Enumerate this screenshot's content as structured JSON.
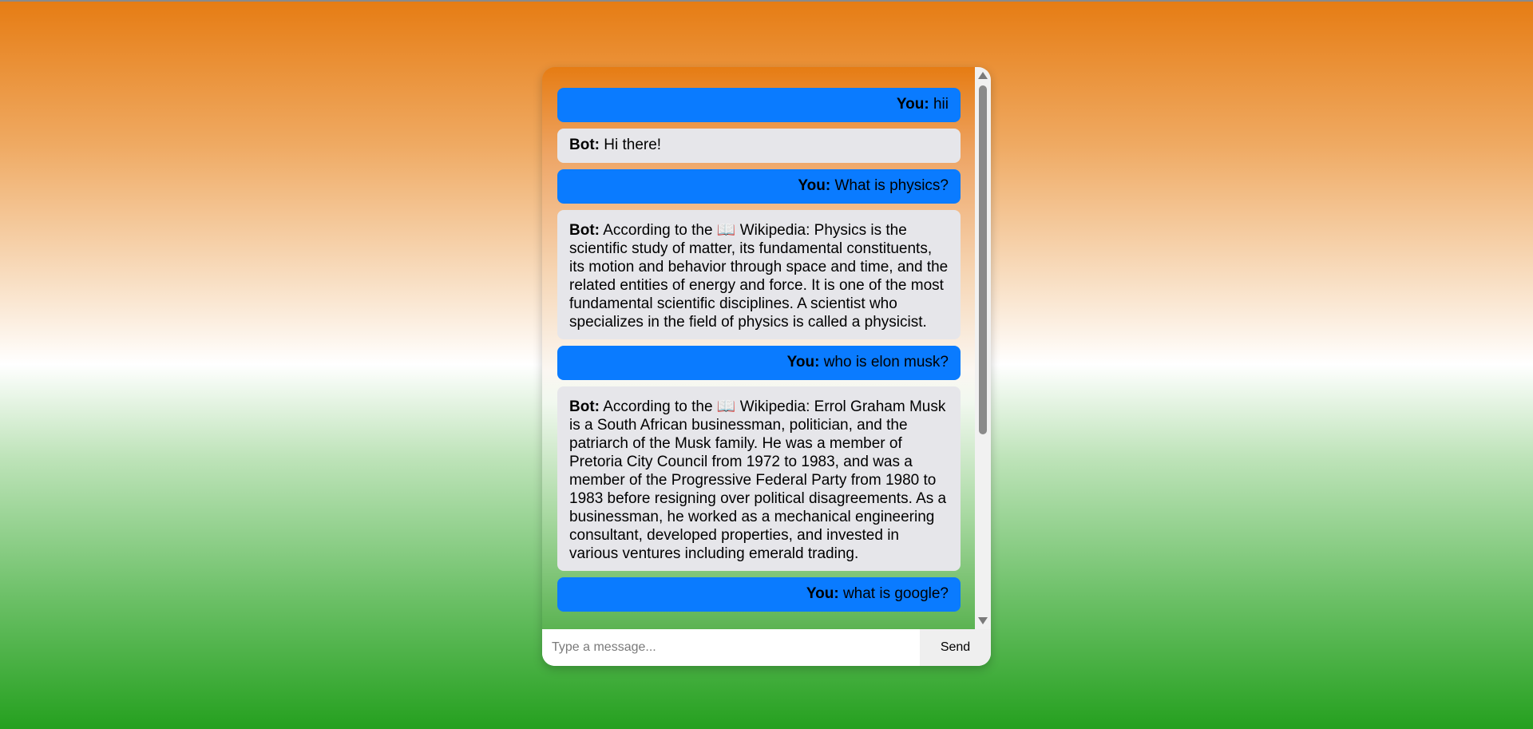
{
  "chat": {
    "messages": [
      {
        "sender": "You:",
        "text": "hii"
      },
      {
        "sender": "Bot:",
        "text": "Hi there!"
      },
      {
        "sender": "You:",
        "text": "What is physics?"
      },
      {
        "sender": "Bot:",
        "text": "According to the 📖 Wikipedia: Physics is the scientific study of matter, its fundamental constituents, its motion and behavior through space and time, and the related entities of energy and force. It is one of the most fundamental scientific disciplines. A scientist who specializes in the field of physics is called a physicist."
      },
      {
        "sender": "You:",
        "text": "who is elon musk?"
      },
      {
        "sender": "Bot:",
        "text": "According to the 📖 Wikipedia: Errol Graham Musk is a South African businessman, politician, and the patriarch of the Musk family. He was a member of Pretoria City Council from 1972 to 1983, and was a member of the Progressive Federal Party from 1980 to 1983 before resigning over political disagreements. As a businessman, he worked as a mechanical engineering consultant, developed properties, and invested in various ventures including emerald trading."
      },
      {
        "sender": "You:",
        "text": "what is google?"
      }
    ]
  },
  "input": {
    "placeholder": "Type a message...",
    "value": ""
  },
  "send_button": {
    "label": "Send"
  },
  "colors": {
    "user_bubble": "#0a7bff",
    "bot_bubble": "#e6e6ea",
    "saffron": "#e67c13",
    "green": "#25a01f"
  }
}
